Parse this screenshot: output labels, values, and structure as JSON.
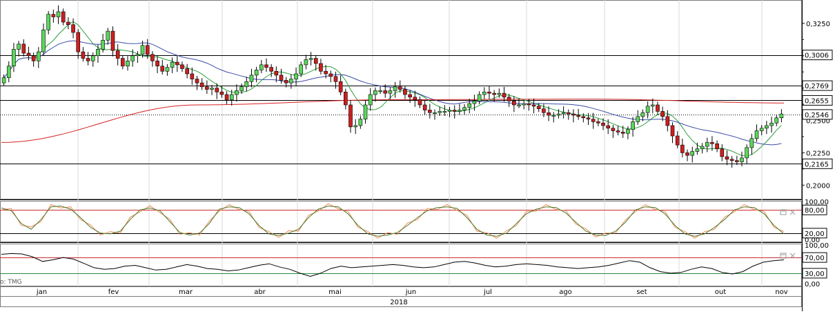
{
  "chart_data": [
    {
      "type": "candlestick",
      "panel": "price",
      "price_ticks": [
        "0,3250",
        "0,2250",
        "0,2000"
      ],
      "partial_tick": "0,2500",
      "levels": [
        {
          "label": "0,3006",
          "value": 0.3006,
          "style": "solid",
          "color": "#000000"
        },
        {
          "label": "0,2769",
          "value": 0.2769,
          "style": "solid",
          "color": "#000000"
        },
        {
          "label": "0,2655",
          "value": 0.2655,
          "style": "solid",
          "color": "#000000"
        },
        {
          "label": "0,2546",
          "value": 0.2546,
          "style": "dotted",
          "color": "#000000"
        },
        {
          "label": "0,2165",
          "value": 0.2165,
          "style": "solid",
          "color": "#000000"
        }
      ],
      "ylim": [
        0.19,
        0.342
      ],
      "approx_closes": [
        0.283,
        0.292,
        0.305,
        0.309,
        0.302,
        0.3,
        0.296,
        0.303,
        0.32,
        0.332,
        0.33,
        0.334,
        0.326,
        0.324,
        0.318,
        0.303,
        0.298,
        0.296,
        0.3,
        0.305,
        0.312,
        0.319,
        0.304,
        0.298,
        0.292,
        0.296,
        0.3,
        0.301,
        0.308,
        0.301,
        0.296,
        0.292,
        0.288,
        0.291,
        0.295,
        0.293,
        0.29,
        0.286,
        0.282,
        0.279,
        0.276,
        0.274,
        0.275,
        0.272,
        0.27,
        0.266,
        0.27,
        0.273,
        0.276,
        0.28,
        0.285,
        0.289,
        0.293,
        0.291,
        0.288,
        0.285,
        0.281,
        0.279,
        0.282,
        0.286,
        0.293,
        0.297,
        0.298,
        0.294,
        0.288,
        0.286,
        0.284,
        0.28,
        0.272,
        0.262,
        0.245,
        0.246,
        0.251,
        0.262,
        0.27,
        0.273,
        0.273,
        0.271,
        0.273,
        0.276,
        0.274,
        0.27,
        0.268,
        0.266,
        0.262,
        0.258,
        0.256,
        0.256,
        0.257,
        0.257,
        0.258,
        0.257,
        0.258,
        0.26,
        0.263,
        0.265,
        0.27,
        0.272,
        0.271,
        0.27,
        0.271,
        0.268,
        0.265,
        0.262,
        0.262,
        0.263,
        0.262,
        0.261,
        0.259,
        0.256,
        0.254,
        0.254,
        0.255,
        0.256,
        0.255,
        0.254,
        0.253,
        0.252,
        0.251,
        0.249,
        0.248,
        0.246,
        0.244,
        0.242,
        0.241,
        0.24,
        0.243,
        0.249,
        0.253,
        0.256,
        0.261,
        0.262,
        0.257,
        0.253,
        0.246,
        0.238,
        0.231,
        0.225,
        0.223,
        0.226,
        0.228,
        0.23,
        0.233,
        0.232,
        0.228,
        0.222,
        0.22,
        0.219,
        0.218,
        0.221,
        0.229,
        0.236,
        0.242,
        0.244,
        0.246,
        0.248,
        0.252,
        0.255
      ],
      "overlays": [
        {
          "name": "",
          "color": "#2a9d3a",
          "kind": "short-ma"
        },
        {
          "name": "",
          "color": "#3b4ba8",
          "kind": "medium-ma"
        },
        {
          "name": "",
          "color": "#d62020",
          "kind": "long-ma",
          "approx_values": [
            0.233,
            0.262,
            0.266,
            0.2665,
            0.2635
          ]
        }
      ],
      "colors": {
        "up": "#5cd65c",
        "down": "#cc1f1f",
        "wick": "#000000"
      }
    },
    {
      "type": "line",
      "panel": "stochastic",
      "ticks": [
        "100,00",
        "80,00",
        "20,00",
        "0,00"
      ],
      "ylim": [
        0,
        100
      ],
      "reference_lines": [
        80,
        20
      ],
      "series_colors": [
        "#4a7a2a",
        "#f08c5a"
      ],
      "approx_values": [
        85,
        78,
        45,
        30,
        55,
        88,
        90,
        82,
        60,
        35,
        20,
        18,
        25,
        55,
        80,
        85,
        78,
        50,
        22,
        15,
        20,
        45,
        82,
        88,
        86,
        70,
        40,
        18,
        14,
        20,
        30,
        60,
        82,
        90,
        88,
        70,
        40,
        18,
        12,
        15,
        22,
        40,
        60,
        78,
        86,
        88,
        84,
        60,
        30,
        15,
        12,
        20,
        45,
        70,
        82,
        88,
        86,
        72,
        48,
        25,
        15,
        14,
        25,
        48,
        80,
        88,
        86,
        70,
        40,
        18,
        12,
        18,
        35,
        55,
        80,
        88,
        86,
        70,
        40,
        18
      ]
    },
    {
      "type": "line",
      "panel": "rsi",
      "ticks": [
        "100,00",
        "70,00",
        "30,00",
        "0,00"
      ],
      "ylim": [
        0,
        100
      ],
      "reference_lines": [
        70,
        30
      ],
      "series_colors": [
        "#000000"
      ],
      "approx_values": [
        78,
        80,
        79,
        72,
        60,
        64,
        70,
        66,
        55,
        44,
        40,
        42,
        48,
        50,
        44,
        38,
        40,
        46,
        52,
        48,
        42,
        40,
        36,
        38,
        44,
        50,
        54,
        46,
        40,
        30,
        22,
        30,
        42,
        48,
        44,
        46,
        48,
        50,
        52,
        50,
        46,
        44,
        46,
        52,
        58,
        60,
        56,
        50,
        46,
        48,
        52,
        54,
        52,
        50,
        46,
        44,
        42,
        44,
        46,
        50,
        56,
        62,
        58,
        44,
        34,
        30,
        32,
        40,
        46,
        42,
        32,
        28,
        34,
        48,
        58,
        62,
        64
      ]
    }
  ],
  "x_axis": {
    "months": [
      "jan",
      "fev",
      "mar",
      "abr",
      "mai",
      "jun",
      "jul",
      "ago",
      "set",
      "out",
      "nov"
    ],
    "year": "2018"
  },
  "watermark": "o: TMG"
}
